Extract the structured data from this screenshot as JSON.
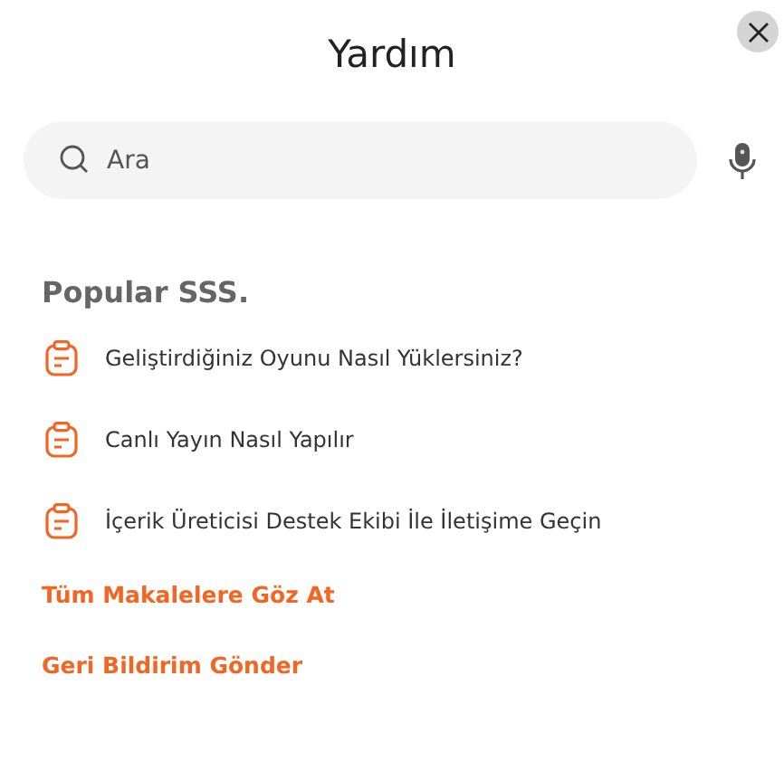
{
  "dialog": {
    "title": "Yardım"
  },
  "search": {
    "placeholder": "Ara"
  },
  "faq": {
    "heading": "Popular SSS.",
    "items": [
      {
        "label": "Geliştirdiğiniz Oyunu Nasıl Yüklersiniz?"
      },
      {
        "label": "Canlı Yayın Nasıl Yapılır"
      },
      {
        "label": "İçerik Üreticisi Destek Ekibi İle İletişime Geçin"
      }
    ]
  },
  "links": [
    "Tüm Makalelere Göz At",
    "Geri Bildirim Gönder"
  ]
}
